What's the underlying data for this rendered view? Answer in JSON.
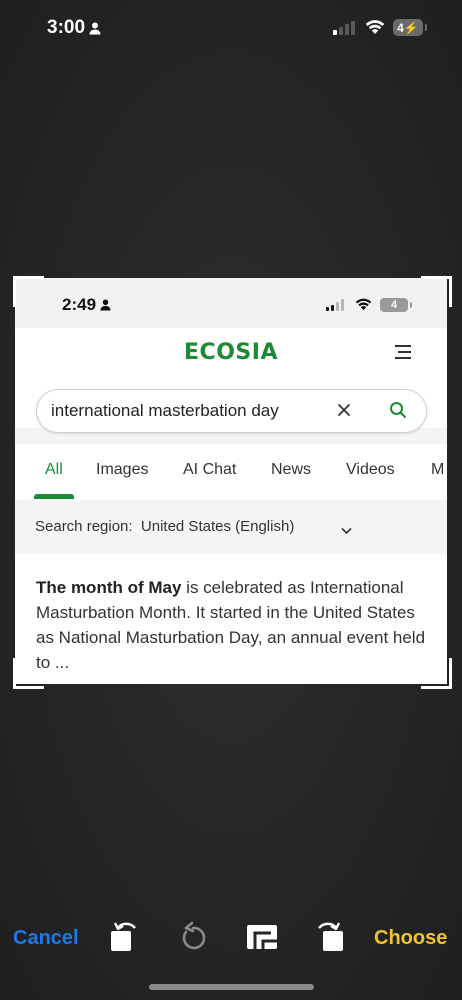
{
  "status_bar": {
    "time": "3:00",
    "battery": "4"
  },
  "screenshot": {
    "status_bar": {
      "time": "2:49",
      "battery": "4"
    },
    "logo": "ECOSIA",
    "search": {
      "query": "international masterbation day"
    },
    "tabs": [
      "All",
      "Images",
      "AI Chat",
      "News",
      "Videos",
      "M"
    ],
    "active_tab": "All",
    "region": {
      "label": "Search region:",
      "value": "United States (English)"
    },
    "result": {
      "bold": "The month of May",
      "text": " is celebrated as International Masturbation Month. It started in the United States as National Masturbation Day, an annual event held to ..."
    }
  },
  "toolbar": {
    "cancel": "Cancel",
    "choose": "Choose"
  },
  "colors": {
    "ecosia_green": "#1d8b36",
    "cancel_blue": "#1e78e6",
    "choose_yellow": "#f2c22a"
  }
}
